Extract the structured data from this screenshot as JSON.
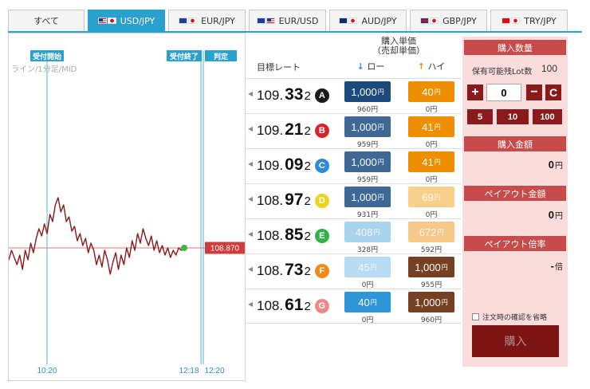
{
  "tabs": [
    {
      "label": "すべて",
      "flags": []
    },
    {
      "label": "USD/JPY",
      "flags": [
        "f-us",
        "f-jp"
      ]
    },
    {
      "label": "EUR/JPY",
      "flags": [
        "f-eu",
        "f-jp"
      ]
    },
    {
      "label": "EUR/USD",
      "flags": [
        "f-eu",
        "f-us"
      ]
    },
    {
      "label": "AUD/JPY",
      "flags": [
        "f-au",
        "f-jp"
      ]
    },
    {
      "label": "GBP/JPY",
      "flags": [
        "f-gb",
        "f-jp"
      ]
    },
    {
      "label": "TRY/JPY",
      "flags": [
        "f-tr",
        "f-jp"
      ]
    }
  ],
  "chart": {
    "start_label": "受付開始",
    "end_label": "受付終了",
    "judge_label": "判定",
    "subtitle": "ライン/1分足/MID",
    "current_price": "108.870",
    "time_start": "10:20",
    "time_end": "12:18",
    "time_judge": "12:20",
    "line_color": "#8b1a1a",
    "price_line_color": "#e07070",
    "marker_color": "#3cb83c",
    "series": [
      108.82,
      108.86,
      108.83,
      108.8,
      108.84,
      108.78,
      108.86,
      108.82,
      108.89,
      108.85,
      108.91,
      108.95,
      108.92,
      108.97,
      108.93,
      109.01,
      108.98,
      109.05,
      109.08,
      109.02,
      109.05,
      108.98,
      109.0,
      108.94,
      108.96,
      108.9,
      108.93,
      108.88,
      108.91,
      108.85,
      108.89,
      108.86,
      108.8,
      108.84,
      108.79,
      108.86,
      108.82,
      108.76,
      108.81,
      108.85,
      108.78,
      108.84,
      108.8,
      108.87,
      108.83,
      108.9,
      108.86,
      108.93,
      108.89,
      108.95,
      108.91,
      108.88,
      108.92,
      108.86,
      108.9,
      108.85,
      108.88,
      108.84,
      108.87,
      108.83,
      108.86,
      108.84,
      108.87,
      108.86,
      108.87
    ]
  },
  "headers": {
    "target_rate": "目標レート",
    "unit_price_line1": "購入単価",
    "unit_price_line2": "（売却単価）",
    "low": "ロー",
    "high": "ハイ"
  },
  "rows": [
    {
      "rate_a": "109.",
      "rate_b": "33",
      "rate_c": "2",
      "badge": "A",
      "badge_color": "#1a1a1a",
      "low_price": "1,000",
      "low_sell": "960円",
      "low_class": "low1",
      "high_price": "40",
      "high_sell": "0円",
      "high_class": "high1"
    },
    {
      "rate_a": "109.",
      "rate_b": "21",
      "rate_c": "2",
      "badge": "B",
      "badge_color": "#d8252b",
      "low_price": "1,000",
      "low_sell": "959円",
      "low_class": "low2",
      "high_price": "41",
      "high_sell": "0円",
      "high_class": "high1"
    },
    {
      "rate_a": "109.",
      "rate_b": "09",
      "rate_c": "2",
      "badge": "C",
      "badge_color": "#2f8ad8",
      "low_price": "1,000",
      "low_sell": "959円",
      "low_class": "low2",
      "high_price": "41",
      "high_sell": "0円",
      "high_class": "high1"
    },
    {
      "rate_a": "108.",
      "rate_b": "97",
      "rate_c": "2",
      "badge": "D",
      "badge_color": "#efd21c",
      "low_price": "1,000",
      "low_sell": "931円",
      "low_class": "low2",
      "high_price": "69",
      "high_sell": "0円",
      "high_class": "high2"
    },
    {
      "rate_a": "108.",
      "rate_b": "85",
      "rate_c": "2",
      "badge": "E",
      "badge_color": "#32b04a",
      "low_price": "408",
      "low_sell": "328円",
      "low_class": "low3",
      "high_price": "672",
      "high_sell": "592円",
      "high_class": "high3"
    },
    {
      "rate_a": "108.",
      "rate_b": "73",
      "rate_c": "2",
      "badge": "F",
      "badge_color": "#f08a18",
      "low_price": "45",
      "low_sell": "0円",
      "low_class": "low4",
      "high_price": "1,000",
      "high_sell": "955円",
      "high_class": "high4"
    },
    {
      "rate_a": "108.",
      "rate_b": "61",
      "rate_c": "2",
      "badge": "G",
      "badge_color": "#f08a8a",
      "low_price": "40",
      "low_sell": "0円",
      "low_class": "low5",
      "high_price": "1,000",
      "high_sell": "960円",
      "high_class": "high4"
    }
  ],
  "panel": {
    "qty_title": "購入数量",
    "lot_label": "保有可能残Lot数",
    "lot_value": "100",
    "plus": "+",
    "qty_value": "0",
    "minus": "−",
    "clear": "C",
    "quick": [
      "5",
      "10",
      "100"
    ],
    "amount_title": "購入金額",
    "amount_value": "0",
    "yen": "円",
    "payout_title": "ペイアウト金額",
    "payout_value": "0",
    "ratio_title": "ペイアウト倍率",
    "ratio_value": "-",
    "ratio_unit": "倍",
    "confirm_label": "注文時の確認を省略",
    "buy_label": "購入"
  }
}
